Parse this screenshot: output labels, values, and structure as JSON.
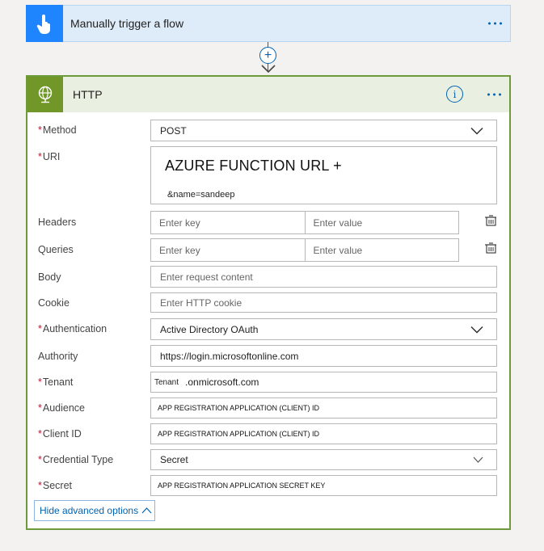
{
  "trigger": {
    "title": "Manually trigger a flow",
    "icon": "hand-touch-icon",
    "color": "#1f85ff"
  },
  "action": {
    "title": "HTTP",
    "icon": "globe-icon",
    "color": "#709727",
    "required_marker": "*",
    "fields": {
      "method": {
        "label": "Method",
        "value": "POST"
      },
      "uri": {
        "label": "URI",
        "value_line1": "AZURE FUNCTION URL +",
        "value_line2": "&name=sandeep"
      },
      "headers": {
        "label": "Headers",
        "key_placeholder": "Enter key",
        "value_placeholder": "Enter value"
      },
      "queries": {
        "label": "Queries",
        "key_placeholder": "Enter key",
        "value_placeholder": "Enter value"
      },
      "body": {
        "label": "Body",
        "placeholder": "Enter request content"
      },
      "cookie": {
        "label": "Cookie",
        "placeholder": "Enter HTTP cookie"
      },
      "authentication": {
        "label": "Authentication",
        "value": "Active Directory OAuth"
      },
      "authority": {
        "label": "Authority",
        "value": "https://login.microsoftonline.com"
      },
      "tenant": {
        "label": "Tenant",
        "value_prefix": "Tenant",
        "value_suffix": ".onmicrosoft.com"
      },
      "audience": {
        "label": "Audience",
        "value": "APP REGISTRATION APPLICATION (CLIENT) ID"
      },
      "client_id": {
        "label": "Client ID",
        "value": "APP REGISTRATION APPLICATION (CLIENT) ID"
      },
      "credential_type": {
        "label": "Credential Type",
        "value": "Secret"
      },
      "secret": {
        "label": "Secret",
        "value": "APP REGISTRATION APPLICATION SECRET KEY"
      }
    },
    "hide_advanced_label": "Hide advanced options"
  }
}
